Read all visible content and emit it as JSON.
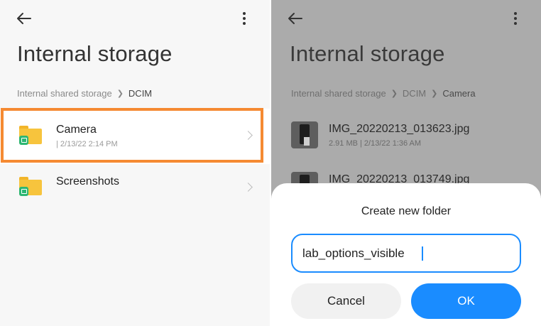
{
  "left": {
    "title": "Internal storage",
    "breadcrumb": {
      "root": "Internal shared storage",
      "current": "DCIM"
    },
    "folders": [
      {
        "name": "Camera",
        "meta": "| 2/13/22 2:14 PM"
      },
      {
        "name": "Screenshots",
        "meta": ""
      }
    ]
  },
  "right": {
    "title": "Internal storage",
    "breadcrumb": {
      "root": "Internal shared storage",
      "middle": "DCIM",
      "current": "Camera"
    },
    "files": [
      {
        "name": "IMG_20220213_013623.jpg",
        "meta": "2.91 MB  |  2/13/22 1:36 AM"
      },
      {
        "name": "IMG_20220213_013749.jpg",
        "meta": ""
      }
    ],
    "dialog": {
      "title": "Create new folder",
      "input_value": "lab_options_visible",
      "cancel_label": "Cancel",
      "ok_label": "OK"
    }
  },
  "colors": {
    "highlight": "#f58a32",
    "accent": "#1a8cff",
    "folder": "#f7c43d",
    "folder_badge": "#2db673"
  },
  "icons": [
    "back-arrow-icon",
    "more-vert-icon",
    "chevron-right-icon",
    "folder-icon"
  ]
}
